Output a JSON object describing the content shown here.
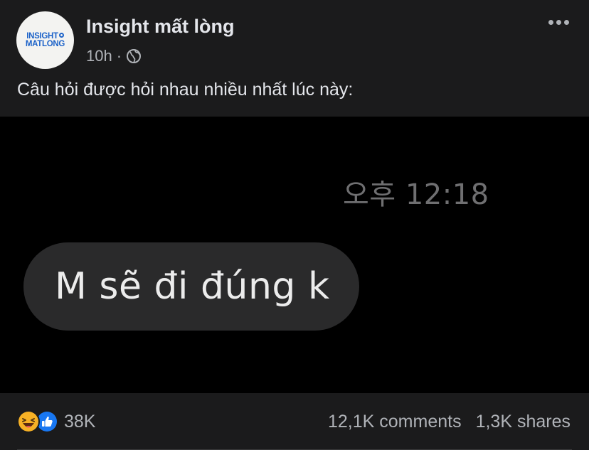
{
  "post": {
    "page_name": "Insight mất lòng",
    "time": "10h",
    "separator": "·",
    "privacy_icon": "globe-icon",
    "caption": "Câu hỏi được hỏi nhau nhiều nhất lúc này:",
    "avatar": {
      "logo_line1": "INSIGHT",
      "logo_line2": "MATLONG",
      "logo_color": "#1d63c9"
    }
  },
  "media": {
    "timestamp": "오후 12:18",
    "bubble_text": "M sẽ đi đúng k"
  },
  "footer": {
    "reaction_icons": [
      "haha-icon",
      "like-icon"
    ],
    "reaction_count": "38K",
    "comments": "12,1K comments",
    "shares": "1,3K shares"
  },
  "colors": {
    "background": "#1b1b1c",
    "media_background": "#000000",
    "bubble": "#2a2a2b",
    "secondary_text": "#b0b3b8",
    "like_blue": "#1877f2",
    "haha_yellow": "#f7b125"
  }
}
